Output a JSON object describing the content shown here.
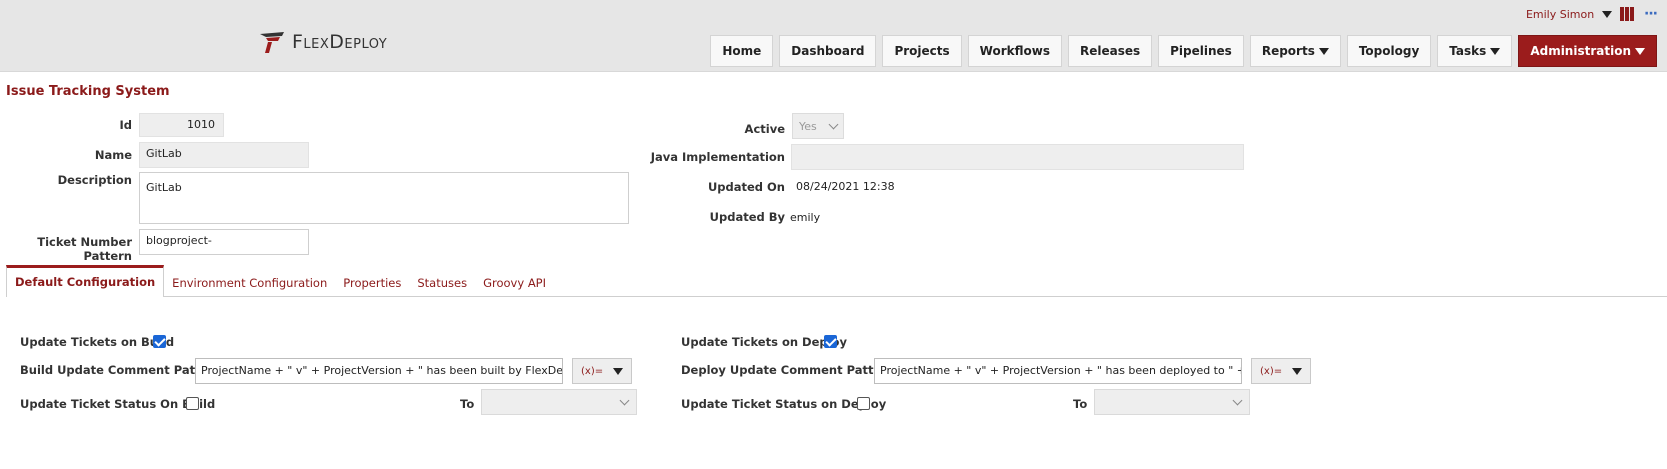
{
  "header": {
    "logo_text": "FlexDeploy",
    "user_name": "Emily Simon",
    "nav": [
      "Home",
      "Dashboard",
      "Projects",
      "Workflows",
      "Releases",
      "Pipelines",
      "Reports",
      "Topology",
      "Tasks",
      "Administration"
    ]
  },
  "page": {
    "title": "Issue Tracking System"
  },
  "form": {
    "id_label": "Id",
    "id_value": "1010",
    "name_label": "Name",
    "name_value": "GitLab",
    "description_label": "Description",
    "description_value": "GitLab",
    "ticket_pattern_label": "Ticket Number Pattern",
    "ticket_pattern_value": "blogproject-",
    "active_label": "Active",
    "active_value": "Yes",
    "java_impl_label": "Java Implementation",
    "java_impl_value": "",
    "updated_on_label": "Updated On",
    "updated_on_value": "08/24/2021 12:38",
    "updated_by_label": "Updated By",
    "updated_by_value": "emily"
  },
  "tabs": [
    "Default Configuration",
    "Environment Configuration",
    "Properties",
    "Statuses",
    "Groovy API"
  ],
  "config": {
    "update_on_build_label": "Update Tickets on Build",
    "update_on_build_checked": true,
    "build_comment_label": "Build Update Comment Pattern",
    "build_comment_value": "ProjectName + \" v\" + ProjectVersion + \" has been built by FlexDeploy \\n\\n\" + F",
    "build_expr_label": "(x)=",
    "status_on_build_label": "Update Ticket Status On Build",
    "status_on_build_checked": false,
    "to_label": "To",
    "update_on_deploy_label": "Update Tickets on Deploy",
    "update_on_deploy_checked": true,
    "deploy_comment_label": "Deploy Update Comment Pattern",
    "deploy_comment_value": "ProjectName + \" v\" + ProjectVersion + \" has been deployed to \" + Environmen",
    "deploy_expr_label": "(x)=",
    "status_on_deploy_label": "Update Ticket Status on Deploy",
    "status_on_deploy_checked": false,
    "to_label_2": "To"
  },
  "colors": {
    "accent": "#9b1c1c",
    "checkbox": "#1a66d6"
  }
}
